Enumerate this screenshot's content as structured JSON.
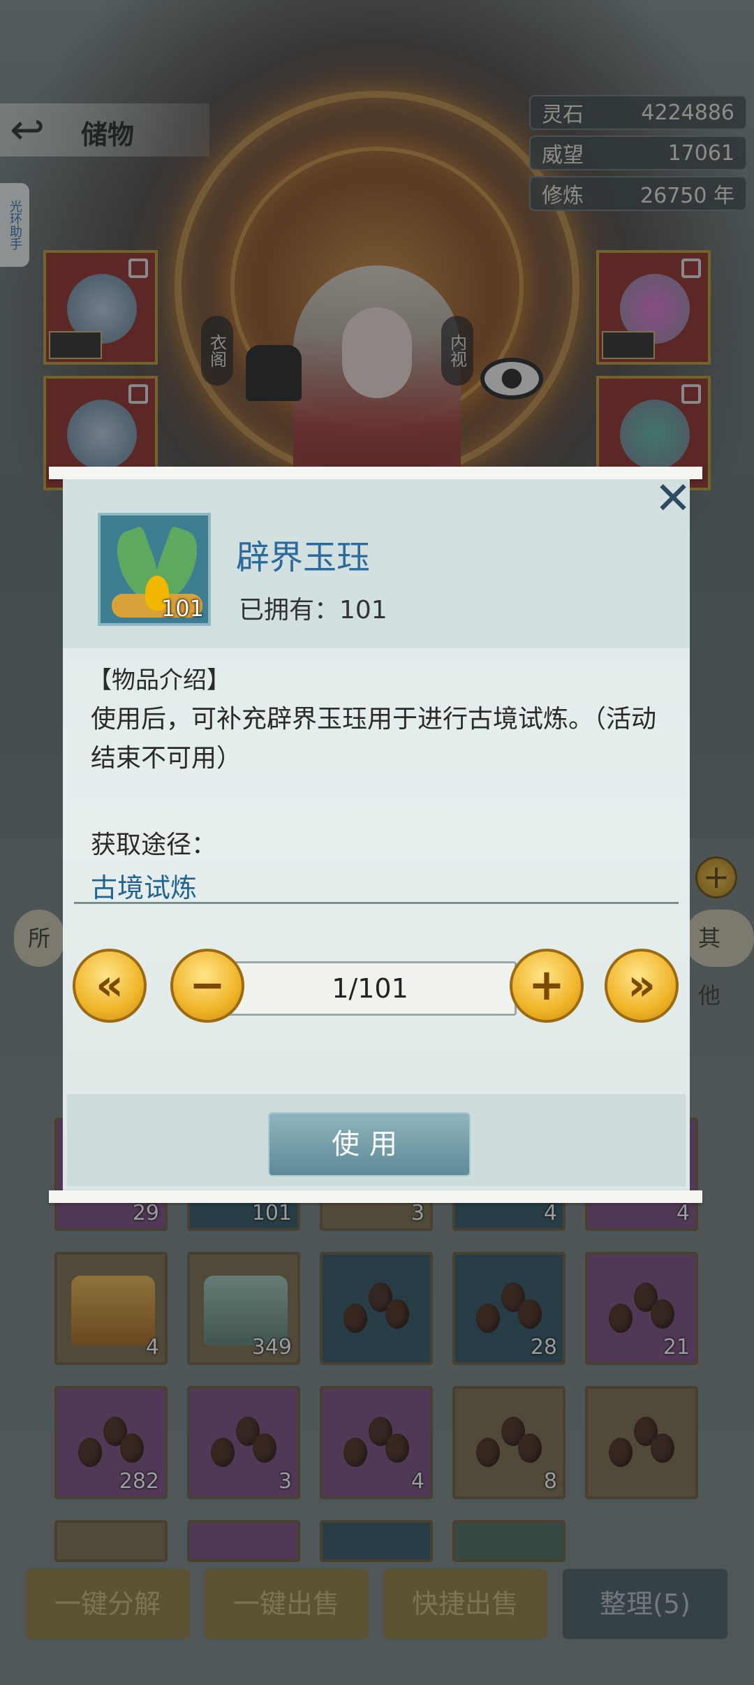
{
  "header": {
    "back_label": "储物",
    "side_tab": "光环助手"
  },
  "stats": [
    {
      "label": "灵石",
      "value": "4224886"
    },
    {
      "label": "威望",
      "value": "17061"
    },
    {
      "label": "修炼",
      "value": "26750 年"
    }
  ],
  "character": {
    "left_label": "衣阁",
    "right_label": "内视"
  },
  "inventory": {
    "filter_left": "所",
    "filter_right": "其他",
    "row_counts_top": [
      "29",
      "101",
      "3",
      "4",
      "4"
    ],
    "row1": [
      {
        "kind": "gold-chest",
        "color": "gold",
        "count": "4"
      },
      {
        "kind": "jade-chest",
        "color": "gold",
        "count": "349"
      },
      {
        "kind": "beans",
        "color": "teal",
        "count": ""
      },
      {
        "kind": "beans",
        "color": "teal",
        "count": "28"
      },
      {
        "kind": "beans",
        "color": "purple",
        "count": "21"
      }
    ],
    "row2": [
      {
        "kind": "beans",
        "color": "purple",
        "count": "282"
      },
      {
        "kind": "beans",
        "color": "purple",
        "count": "3"
      },
      {
        "kind": "beans",
        "color": "purple",
        "count": "4"
      },
      {
        "kind": "beans",
        "color": "gold",
        "count": "8"
      },
      {
        "kind": "beans",
        "color": "gold",
        "count": ""
      }
    ]
  },
  "bottom_buttons": [
    "一键分解",
    "一键出售",
    "快捷出售",
    "整理(5)"
  ],
  "popup": {
    "item_name": "辟界玉珏",
    "icon_count": "101",
    "owned": "已拥有：101",
    "desc_title": "【物品介绍】",
    "desc": "使用后，可补充辟界玉珏用于进行古境试炼。（活动结束不可用）",
    "source_title": "获取途径：",
    "source_link": "古境试炼",
    "quantity": "1/101",
    "use_label": "使用",
    "close": "✕",
    "btn_first": "«",
    "btn_minus": "−",
    "btn_plus": "+",
    "btn_last": "»"
  }
}
